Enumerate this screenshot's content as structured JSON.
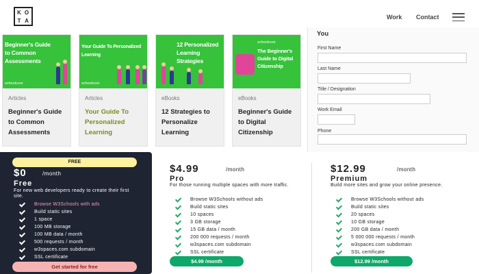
{
  "header": {
    "logo_letters": [
      "K",
      "O",
      "T",
      "A"
    ],
    "nav": [
      "Work",
      "Contact"
    ]
  },
  "cards": [
    {
      "image_text": "Beginner's Guide to Common Assessments",
      "brand": "schoolcoor",
      "category": "Articles",
      "title": "Beginner's Guide to Common Assessments",
      "title_color": "#222222"
    },
    {
      "image_text": "Your Guide To Personalized Learning",
      "brand": "schoolcoor",
      "category": "Articles",
      "title": "Your Guide To Personalized Learning",
      "title_color": "#7a8d1a"
    },
    {
      "image_text": "12 Personalized Learning Strategies",
      "brand": "",
      "category": "eBooks",
      "title": "12 Strategies to Personalize Learning",
      "title_color": "#222222"
    },
    {
      "image_text": "The Beginner's Guide to Digital Citizenship",
      "brand": "schoolcoor",
      "category": "eBooks",
      "title": "Beginner's Guide to Digital Citizenship",
      "title_color": "#222222"
    }
  ],
  "form": {
    "heading": "You",
    "fields": [
      "First Name",
      "Last Name",
      "Title / Designation",
      "Work Email",
      "Phone"
    ]
  },
  "plans": {
    "free": {
      "badge": "FREE",
      "price": "$0",
      "per": "/month",
      "name": "Free",
      "desc": "For new web developers ready to create their first site.",
      "features": [
        "Browse W3Schools with ads",
        "Build static sites",
        "1 space",
        "100 MB storage",
        "100 MB data / month",
        "500 requests / month",
        "w3spaces.com subdomain",
        "SSL certificate"
      ],
      "button": "Get started for free"
    },
    "pro": {
      "price": "$4.99",
      "per": "/month",
      "name": "Pro",
      "desc": "For those running multiple spaces with more traffic.",
      "features": [
        "Browse W3Schools without ads",
        "Build static sites",
        "10 spaces",
        "3 GB storage",
        "15 GB data / month",
        "200 000 requests / month",
        "w3spaces.com subdomain",
        "SSL certificate"
      ],
      "button": "$4.99 /month"
    },
    "premium": {
      "price": "$12.99",
      "per": "/month",
      "name": "Premium",
      "desc": "Build more sites and grow your online presence.",
      "features": [
        "Browse W3Schools without ads",
        "Build static sites",
        "20 spaces",
        "10 GB storage",
        "200 GB data / month",
        "5 000 000 requests / month",
        "w3spaces.com subdomain",
        "SSL certificate"
      ],
      "button": "$12.99 /month"
    }
  },
  "colors": {
    "card_green": "#36c23a",
    "dark_panel": "#1f2432",
    "free_badge": "#fdf0a0",
    "free_button": "#f6b3b3",
    "paid_button": "#0ea86a",
    "highlight_feature": "#f59fc0"
  }
}
